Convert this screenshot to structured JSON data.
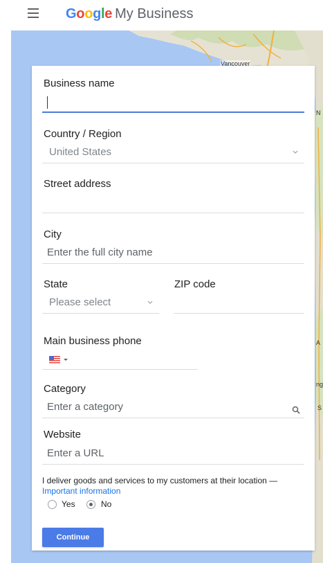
{
  "header": {
    "brand_google": "Google",
    "brand_product": "My Business"
  },
  "map": {
    "label_vancouver": "Vancouver",
    "edge_fragment_1": "N",
    "edge_fragment_2": "A",
    "edge_fragment_3": "ng",
    "edge_fragment_4": "S"
  },
  "form": {
    "business_name": {
      "label": "Business name",
      "value": ""
    },
    "country": {
      "label": "Country / Region",
      "value": "United States"
    },
    "street": {
      "label": "Street address",
      "value": ""
    },
    "city": {
      "label": "City",
      "placeholder": "Enter the full city name"
    },
    "state": {
      "label": "State",
      "placeholder": "Please select"
    },
    "zip": {
      "label": "ZIP code",
      "value": ""
    },
    "phone": {
      "label": "Main business phone",
      "value": ""
    },
    "category": {
      "label": "Category",
      "placeholder": "Enter a category"
    },
    "website": {
      "label": "Website",
      "placeholder": "Enter a URL"
    },
    "delivery": {
      "question": "I deliver goods and services to my customers at their location —",
      "link": "Important information",
      "options": [
        "Yes",
        "No"
      ],
      "selected": "No"
    },
    "continue_label": "Continue"
  },
  "colors": {
    "accent": "#4a7be6",
    "link": "#1a73e8",
    "map_water": "#a8c7f2"
  }
}
